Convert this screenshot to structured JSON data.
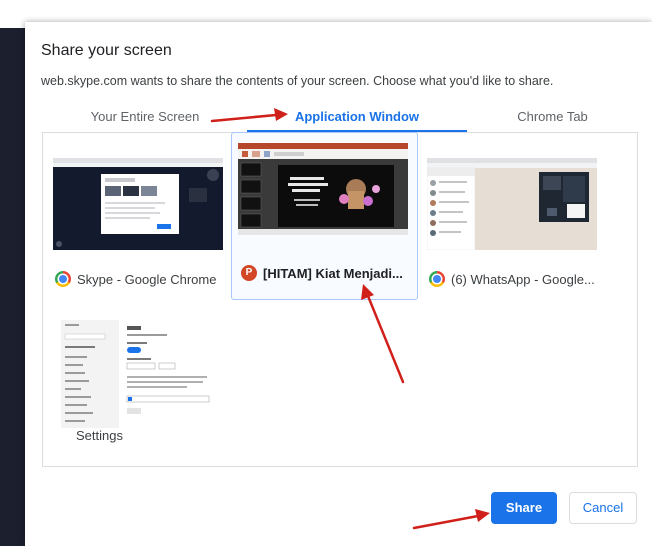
{
  "dialog": {
    "title": "Share your screen",
    "description": "web.skype.com wants to share the contents of your screen. Choose what you'd like to share."
  },
  "tabs": [
    {
      "label": "Your Entire Screen",
      "active": false
    },
    {
      "label": "Application Window",
      "active": true
    },
    {
      "label": "Chrome Tab",
      "active": false
    }
  ],
  "windows": [
    {
      "label": "Skype - Google Chrome",
      "icon": "chrome-icon",
      "selected": false
    },
    {
      "label": "[HITAM] Kiat Menjadi...",
      "icon": "powerpoint-icon",
      "icon_letter": "P",
      "selected": true
    },
    {
      "label": "(6) WhatsApp - Google...",
      "icon": "chrome-icon",
      "selected": false
    },
    {
      "label": "Settings",
      "icon": "none",
      "selected": false
    }
  ],
  "buttons": {
    "share": "Share",
    "cancel": "Cancel"
  },
  "colors": {
    "accent": "#1a73e8",
    "annotation_arrow": "#d0201a",
    "powerpoint": "#d24726"
  }
}
